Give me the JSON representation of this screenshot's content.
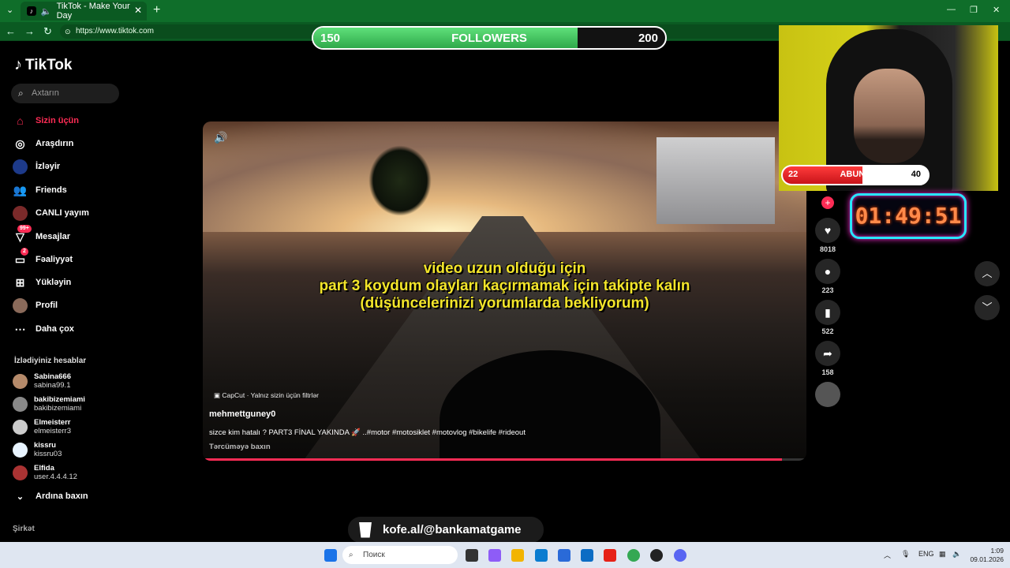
{
  "browser": {
    "tab_title": "TikTok - Make Your Day",
    "url": "https://www.tiktok.com"
  },
  "followers_overlay": {
    "current": "150",
    "label": "FOLLOWERS",
    "goal": "200",
    "progress": 0.75,
    "color": "#3cc25a"
  },
  "sidebar": {
    "brand": "TikTok",
    "search_placeholder": "Axtarın",
    "nav": [
      {
        "label": "Sizin üçün",
        "icon": "home-icon",
        "active": true
      },
      {
        "label": "Araşdırın",
        "icon": "compass-icon"
      },
      {
        "label": "İzləyir",
        "icon": "following-icon"
      },
      {
        "label": "Friends",
        "icon": "friends-icon"
      },
      {
        "label": "CANLI yayım",
        "icon": "live-icon"
      },
      {
        "label": "Mesajlar",
        "icon": "messages-icon",
        "badge": "99+"
      },
      {
        "label": "Fəaliyyət",
        "icon": "activity-icon",
        "badge": "2"
      },
      {
        "label": "Yükləyin",
        "icon": "upload-icon"
      },
      {
        "label": "Profil",
        "icon": "profile-icon"
      },
      {
        "label": "Daha çox",
        "icon": "more-icon"
      }
    ],
    "followed_heading": "İzlədiyiniz hesablar",
    "accounts": [
      {
        "name": "Sabina666",
        "user": "sabina99.1"
      },
      {
        "name": "bakibizemiami",
        "user": "bakibizemiami"
      },
      {
        "name": "Elmeisterr",
        "user": "elmeisterr3"
      },
      {
        "name": "kissru",
        "user": "kissru03"
      },
      {
        "name": "Elfida",
        "user": "user.4.4.4.12"
      }
    ],
    "see_more": "Ardına baxın",
    "company": "Şirkət",
    "accent": "#fe2c55"
  },
  "video": {
    "subtitle_line1": "video uzun olduğu için",
    "subtitle_line2": "part 3 koydum olayları kaçırmamak için takipte kalın",
    "subtitle_line3": "(düşüncelerinizi yorumlarda bekliyorum)",
    "capcut": "CapCut · Yalnız sizin üçün filtrlər",
    "author": "mehmettguney0",
    "caption": "sizce kim hatalı ?  PART3 FİNAL YAKINDA 🚀 ..#motor #motosiklet #motovlog #bikelife  #rideout",
    "translate": "Tərcüməyə baxın",
    "progress": 0.96
  },
  "actions": {
    "likes": "8018",
    "comments": "223",
    "saves": "522",
    "shares": "158"
  },
  "stream": {
    "abune_current": "22",
    "abune_label": "ABUNE",
    "abune_goal": "40",
    "abune_progress": 0.55,
    "timer": "01:49:51",
    "kofe": "kofe.al/@bankamatgame"
  },
  "taskbar": {
    "search": "Поиск",
    "lang": "ENG",
    "time": "1:09",
    "date": "09.01.2026"
  }
}
